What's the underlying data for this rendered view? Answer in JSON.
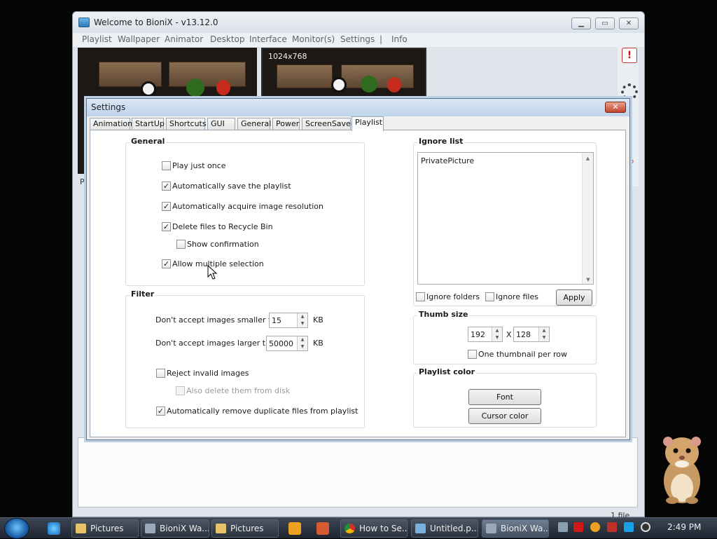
{
  "main_window": {
    "title": "Welcome to BioniX -  v13.12.0",
    "menu": [
      "Playlist",
      "Wallpaper",
      "Animator",
      "Desktop",
      "Interface",
      "Monitor(s)",
      "Settings",
      "|",
      "Info"
    ],
    "preview_resolution": "1024x768",
    "status_count": "1 file",
    "side_fragments": {
      "a": "P",
      "b": "o"
    }
  },
  "settings": {
    "title": "Settings",
    "close_glyph": "✕",
    "tabs": [
      "Animation",
      "StartUp",
      "Shortcuts",
      "GUI",
      "General",
      "Power",
      "ScreenSaver",
      "Playlist"
    ],
    "active_tab": "Playlist",
    "general": {
      "label": "General",
      "play_just_once": "Play just once",
      "auto_save": "Automatically save the playlist",
      "auto_resolution": "Automatically acquire image resolution",
      "recycle_bin": "Delete files to Recycle Bin",
      "show_confirmation": "Show confirmation",
      "multiple_selection": "Allow multiple selection"
    },
    "filter": {
      "label": "Filter",
      "smaller_label": "Don't accept images smaller than",
      "smaller_value": "15",
      "smaller_unit": "KB",
      "larger_label": "Don't accept images larger than",
      "larger_value": "50000",
      "larger_unit": "KB",
      "reject_invalid": "Reject invalid images",
      "also_delete": "Also delete them from disk",
      "remove_duplicates": "Automatically remove duplicate files from playlist"
    },
    "ignore_list": {
      "label": "Ignore list",
      "items": [
        "PrivatePicture"
      ],
      "ignore_folders": "Ignore folders",
      "ignore_files": "Ignore files",
      "apply": "Apply"
    },
    "thumb_size": {
      "label": "Thumb size",
      "width": "192",
      "separator": "X",
      "height": "128",
      "one_per_row": "One thumbnail per row"
    },
    "playlist_color": {
      "label": "Playlist color",
      "font": "Font",
      "cursor_color": "Cursor color"
    },
    "checked": {
      "play_just_once": false,
      "auto_save": true,
      "auto_resolution": true,
      "recycle_bin": true,
      "show_confirmation": false,
      "multiple_selection": true,
      "reject_invalid": false,
      "also_delete": false,
      "remove_duplicates": true,
      "ignore_folders": false,
      "ignore_files": false,
      "one_per_row": false
    }
  },
  "taskbar": {
    "buttons": [
      "Pictures",
      "BioniX Wa...",
      "Pictures",
      "How to Se...",
      "Untitled.p...",
      "BioniX Wa..."
    ],
    "active_button": 5,
    "clock": "2:49 PM"
  },
  "colors": {
    "taskbar": "#2b323c",
    "dialog_border": "#5d7190",
    "close_red": "#c4432a",
    "alert_red": "#d01010"
  },
  "icons": [
    "app-icon",
    "alert-icon",
    "spinner-icon",
    "close-icon",
    "start-orb-icon",
    "ie-icon",
    "media-player-icon",
    "folder-icon",
    "chrome-icon",
    "hamster-icon"
  ]
}
